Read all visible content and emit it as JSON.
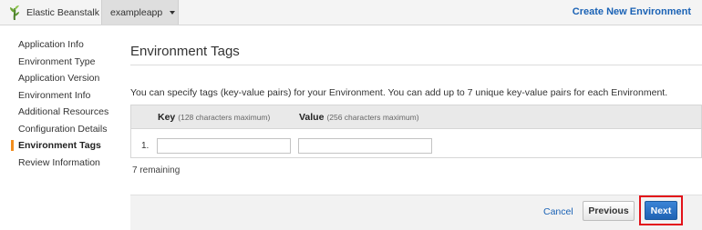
{
  "topbar": {
    "brand": "Elastic Beanstalk",
    "app_selector": "exampleapp",
    "create_env": "Create New Environment"
  },
  "sidebar": {
    "items": [
      {
        "label": "Application Info",
        "active": false
      },
      {
        "label": "Environment Type",
        "active": false
      },
      {
        "label": "Application Version",
        "active": false
      },
      {
        "label": "Environment Info",
        "active": false
      },
      {
        "label": "Additional Resources",
        "active": false
      },
      {
        "label": "Configuration Details",
        "active": false
      },
      {
        "label": "Environment Tags",
        "active": true
      },
      {
        "label": "Review Information",
        "active": false
      }
    ]
  },
  "main": {
    "title": "Environment Tags",
    "description": "You can specify tags (key-value pairs) for your Environment. You can add up to 7 unique key-value pairs for each Environment.",
    "table": {
      "key_header": "Key",
      "key_hint": "(128 characters maximum)",
      "value_header": "Value",
      "value_hint": "(256 characters maximum)",
      "rows": [
        {
          "number": "1.",
          "key": "",
          "value": ""
        }
      ]
    },
    "remaining": "7 remaining"
  },
  "footer": {
    "cancel": "Cancel",
    "previous": "Previous",
    "next": "Next"
  },
  "colors": {
    "link": "#1a62b5",
    "active_marker": "#f28d1e",
    "next_button": "#2a6fc2",
    "highlight": "#e3121a"
  }
}
